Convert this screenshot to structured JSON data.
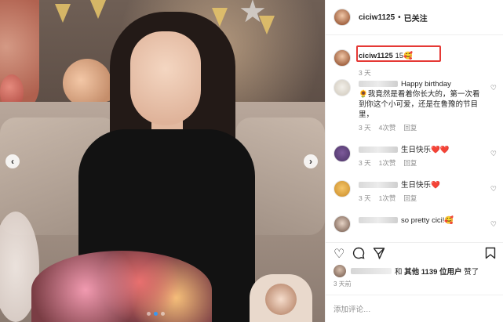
{
  "header": {
    "username": "ciciw1125",
    "separator": "•",
    "follow_status": "已关注"
  },
  "caption": {
    "username": "ciciw1125",
    "text": "15",
    "emoji": "🥰",
    "time": "3 天"
  },
  "comments": [
    {
      "text": "Happy birthday\n🌻我竟然是看着你长大的，第一次看到你这个小可爱，还是在鲁豫的节目里，",
      "time": "3 天",
      "likes": "4次赞",
      "reply": "回复"
    },
    {
      "text": "生日快乐❤️❤️",
      "time": "3 天",
      "likes": "1次赞",
      "reply": "回复"
    },
    {
      "text": "生日快乐❤️",
      "time": "3 天",
      "likes": "1次赞",
      "reply": "回复"
    },
    {
      "text": "so pretty cici!🥰"
    }
  ],
  "likes_line": {
    "conj": "和",
    "others": "其他 1139 位用户",
    "suffix": "赞了"
  },
  "post_time": "3 天前",
  "add_comment_placeholder": "添加评论…",
  "photo": {
    "prev_arrow": "‹",
    "next_arrow": "›",
    "slide_count": 3,
    "active_slide": 2
  },
  "icons": {
    "like": "heart-outline-icon",
    "comment": "comment-icon",
    "share": "share-icon",
    "save": "bookmark-icon"
  },
  "colors": {
    "highlight_box": "#e53935",
    "link_blue": "#3897f0",
    "muted": "#8e8e8e"
  }
}
